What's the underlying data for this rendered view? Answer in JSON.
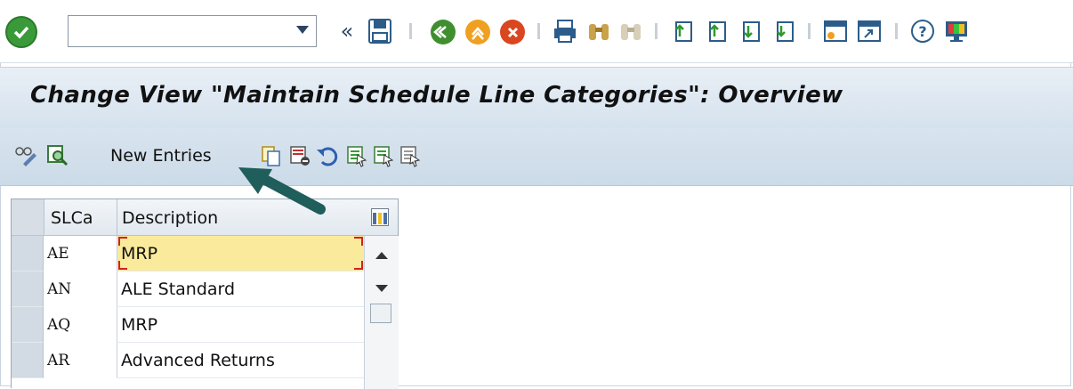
{
  "toolbar": {
    "command_field_value": "",
    "icons": [
      "enter-icon",
      "command-dropdown-icon",
      "back-chevron-icon",
      "save-icon",
      "back-icon",
      "exit-icon",
      "cancel-icon",
      "print-icon",
      "find-icon",
      "find-next-icon",
      "first-page-icon",
      "previous-page-icon",
      "next-page-icon",
      "last-page-icon",
      "create-session-icon",
      "generate-shortcut-icon",
      "help-icon",
      "customize-layout-icon"
    ]
  },
  "title": "Change View \"Maintain Schedule Line Categories\": Overview",
  "app_toolbar": {
    "new_entries_label": "New Entries",
    "icons": [
      "display-change-icon",
      "find-icon",
      "copy-as-icon",
      "delete-icon",
      "undo-icon",
      "select-all-icon",
      "select-block-icon",
      "deselect-all-icon"
    ]
  },
  "table": {
    "columns": [
      "SLCa",
      "Description"
    ],
    "rows": [
      {
        "code": "AE",
        "description": "MRP"
      },
      {
        "code": "AN",
        "description": "ALE Standard"
      },
      {
        "code": "AQ",
        "description": "MRP"
      },
      {
        "code": "AR",
        "description": "Advanced Returns"
      }
    ]
  },
  "colors": {
    "title_bg": "#dde7f1",
    "active_cell": "#faeb9c",
    "annotation_arrow": "#1f5e5a"
  }
}
